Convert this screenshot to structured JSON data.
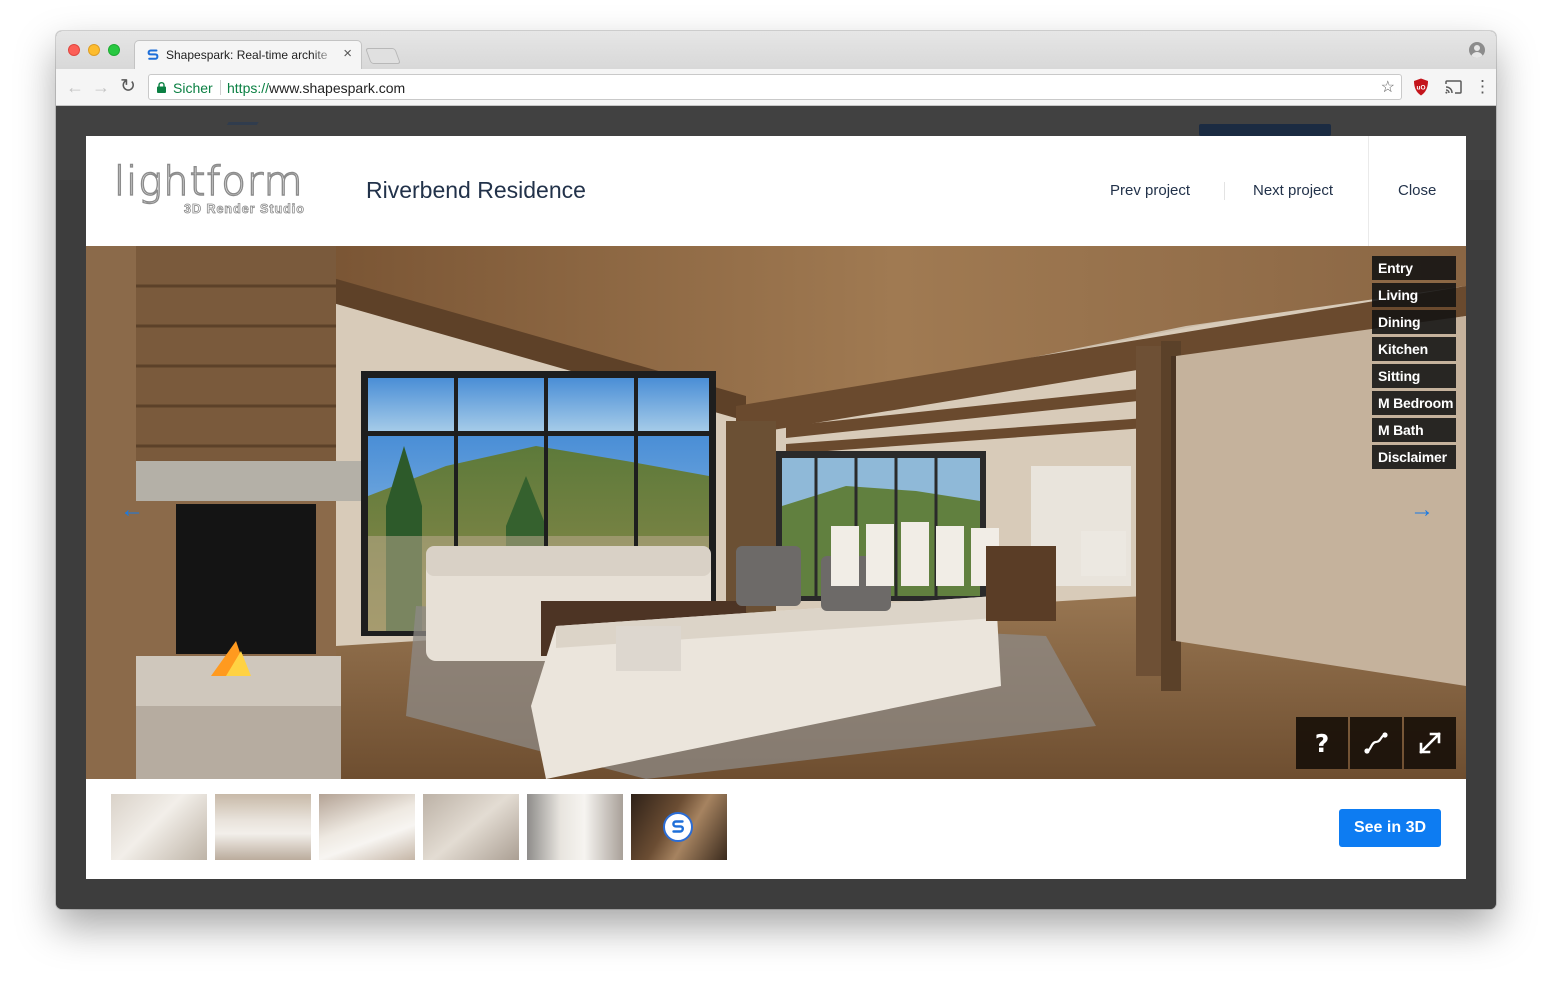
{
  "browser": {
    "tab_title": "Shapespark: Real-time archite",
    "tab_close": "×",
    "security_label": "Sicher",
    "url_scheme": "https://",
    "url_host": "www.shapespark.com",
    "icons": [
      "back-arrow-icon",
      "forward-arrow-icon",
      "reload-icon",
      "lock-icon",
      "star-icon",
      "ublock-icon",
      "cast-icon",
      "menu-dots-icon",
      "profile-icon"
    ]
  },
  "modal": {
    "brand": {
      "name": "lightform",
      "subtitle": "3D Render Studio"
    },
    "title": "Riverbend Residence",
    "prev_label": "Prev project",
    "next_label": "Next project",
    "close_label": "Close"
  },
  "viewer": {
    "rooms": [
      "Entry",
      "Living",
      "Dining",
      "Kitchen",
      "Sitting",
      "M Bedroom",
      "M Bath",
      "Disclaimer"
    ],
    "nav": {
      "prev_arrow": "←",
      "next_arrow": "→"
    },
    "controls": {
      "help_label": "?",
      "path_icon": "path-icon",
      "fullscreen_icon": "fullscreen-icon"
    }
  },
  "footer": {
    "thumbnails": [
      "living-room",
      "living-room-wide",
      "dining",
      "bedroom",
      "bathroom",
      "shapespark-logo"
    ],
    "see_3d_label": "See in 3D"
  },
  "colors": {
    "accent_blue": "#0d7cf2",
    "title_navy": "#22324a",
    "secure_green": "#0b8043",
    "page_backdrop": "#3d3d3d"
  }
}
